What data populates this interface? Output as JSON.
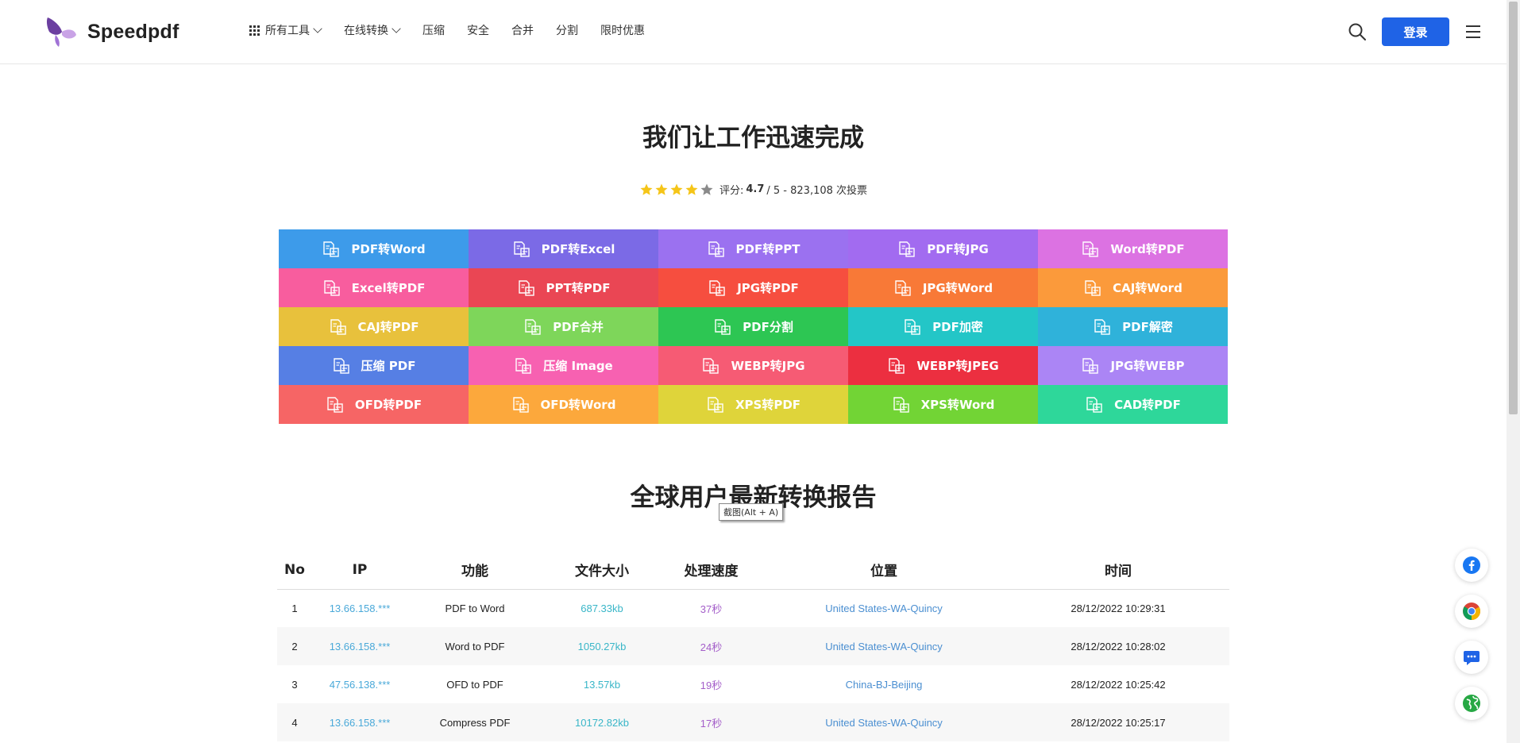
{
  "header": {
    "logo_text": "Speedpdf",
    "nav": [
      {
        "label": "所有工具",
        "has_grid_icon": true,
        "has_dropdown": true
      },
      {
        "label": "在线转换",
        "has_grid_icon": false,
        "has_dropdown": true
      },
      {
        "label": "压缩"
      },
      {
        "label": "安全"
      },
      {
        "label": "合并"
      },
      {
        "label": "分割"
      },
      {
        "label": "限时优惠"
      }
    ],
    "login_label": "登录"
  },
  "hero": {
    "title": "我们让工作迅速完成",
    "rating_prefix": "评分:",
    "rating_score": "4.7",
    "rating_suffix": "/ 5 - 823,108 次投票",
    "stars_filled": 4,
    "stars_total": 5
  },
  "tools": [
    {
      "label": "PDF转Word",
      "color": "#3d9bea"
    },
    {
      "label": "PDF转Excel",
      "color": "#7b6ae6"
    },
    {
      "label": "PDF转PPT",
      "color": "#9b71f0"
    },
    {
      "label": "PDF转JPG",
      "color": "#a26bf0"
    },
    {
      "label": "Word转PDF",
      "color": "#dc72e2"
    },
    {
      "label": "Excel转PDF",
      "color": "#f85d9e"
    },
    {
      "label": "PPT转PDF",
      "color": "#ea4654"
    },
    {
      "label": "JPG转PDF",
      "color": "#f64e3f"
    },
    {
      "label": "JPG转Word",
      "color": "#f87937"
    },
    {
      "label": "CAJ转Word",
      "color": "#fb9a3b"
    },
    {
      "label": "CAJ转PDF",
      "color": "#e8c13c"
    },
    {
      "label": "PDF合并",
      "color": "#7ed65a"
    },
    {
      "label": "PDF分割",
      "color": "#2dc653"
    },
    {
      "label": "PDF加密",
      "color": "#23c6c7"
    },
    {
      "label": "PDF解密",
      "color": "#2fb2da"
    },
    {
      "label": "压缩 PDF",
      "color": "#567fe4"
    },
    {
      "label": "压缩 Image",
      "color": "#f761b1"
    },
    {
      "label": "WEBP转JPG",
      "color": "#f65b74"
    },
    {
      "label": "WEBP转JPEG",
      "color": "#ec2f40"
    },
    {
      "label": "JPG转WEBP",
      "color": "#ab85f5"
    },
    {
      "label": "OFD转PDF",
      "color": "#f66565"
    },
    {
      "label": "OFD转Word",
      "color": "#fca83c"
    },
    {
      "label": "XPS转PDF",
      "color": "#dfd43a"
    },
    {
      "label": "XPS转Word",
      "color": "#72d435"
    },
    {
      "label": "CAD转PDF",
      "color": "#2ed79a"
    }
  ],
  "report": {
    "title": "全球用户最新转换报告",
    "tooltip": "截图(Alt + A)",
    "columns": [
      "No",
      "IP",
      "功能",
      "文件大小",
      "处理速度",
      "位置",
      "时间"
    ],
    "rows": [
      {
        "no": "1",
        "ip": "13.66.158.***",
        "func": "PDF to Word",
        "size": "687.33kb",
        "speed": "37秒",
        "loc": "United States-WA-Quincy",
        "time": "28/12/2022 10:29:31"
      },
      {
        "no": "2",
        "ip": "13.66.158.***",
        "func": "Word to PDF",
        "size": "1050.27kb",
        "speed": "24秒",
        "loc": "United States-WA-Quincy",
        "time": "28/12/2022 10:28:02"
      },
      {
        "no": "3",
        "ip": "47.56.138.***",
        "func": "OFD to PDF",
        "size": "13.57kb",
        "speed": "19秒",
        "loc": "China-BJ-Beijing",
        "time": "28/12/2022 10:25:42"
      },
      {
        "no": "4",
        "ip": "13.66.158.***",
        "func": "Compress PDF",
        "size": "10172.82kb",
        "speed": "17秒",
        "loc": "United States-WA-Quincy",
        "time": "28/12/2022 10:25:17"
      }
    ]
  },
  "floating_icons": [
    "facebook-icon",
    "chrome-icon",
    "chat-icon",
    "globe-icon"
  ],
  "colors": {
    "accent": "#1f63e6",
    "star": "#f5c518",
    "star_empty": "#8a8a8a"
  }
}
